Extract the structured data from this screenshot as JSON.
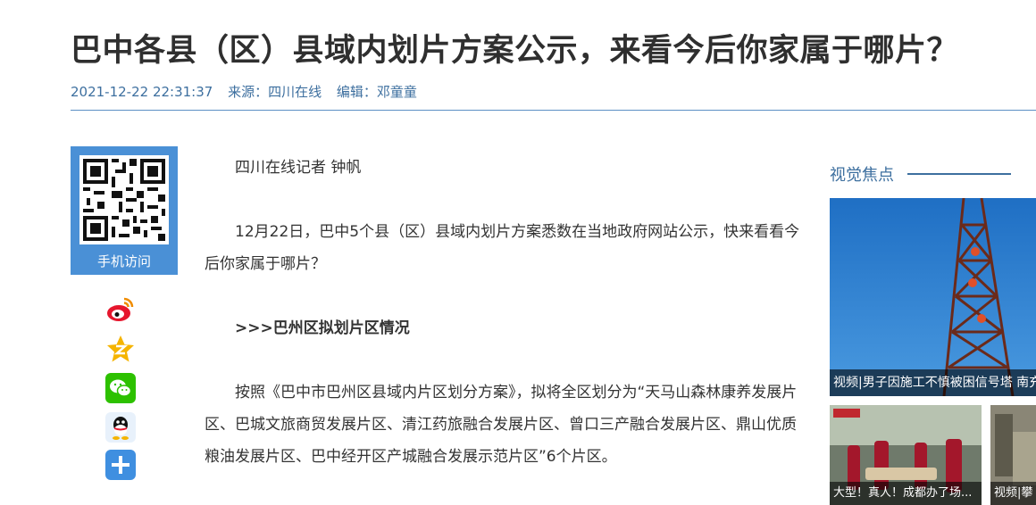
{
  "article": {
    "title": "巴中各县（区）县域内划片方案公示，来看今后你家属于哪片？",
    "datetime": "2021-12-22 22:31:37",
    "source": "来源：四川在线",
    "editor": "编辑：邓童童",
    "paragraphs": [
      "四川在线记者 钟帆",
      "12月22日，巴中5个县（区）县域内划片方案悉数在当地政府网站公示，快来看看今后你家属于哪片？",
      ">>>巴州区拟划片区情况",
      "按照《巴中市巴州区县域内片区划分方案》，拟将全区划分为“天马山森林康养发展片区、巴城文旅商贸发展片区、清江药旅融合发展片区、曾口三产融合发展片区、鼎山优质粮油发展片区、巴中经开区产城融合发展示范片区”6个片区。"
    ]
  },
  "share_panel": {
    "qr_label": "手机访问",
    "icons": [
      "weibo-icon",
      "qzone-icon",
      "wechat-icon",
      "qq-icon",
      "more-share-icon"
    ]
  },
  "sidebar": {
    "heading": "视觉焦点",
    "featured_caption": "视频|男子因施工不慎被困信号塔 南充",
    "thumb1_caption": "大型！真人！成都办了场...",
    "thumb2_caption": "视频|攀"
  },
  "colors": {
    "accent": "#3d6f9f",
    "qr_bg": "#4a90d6",
    "weibo": "#e6162d",
    "qzone": "#f5b400",
    "wechat": "#2dc100",
    "more": "#3f8fe0"
  }
}
